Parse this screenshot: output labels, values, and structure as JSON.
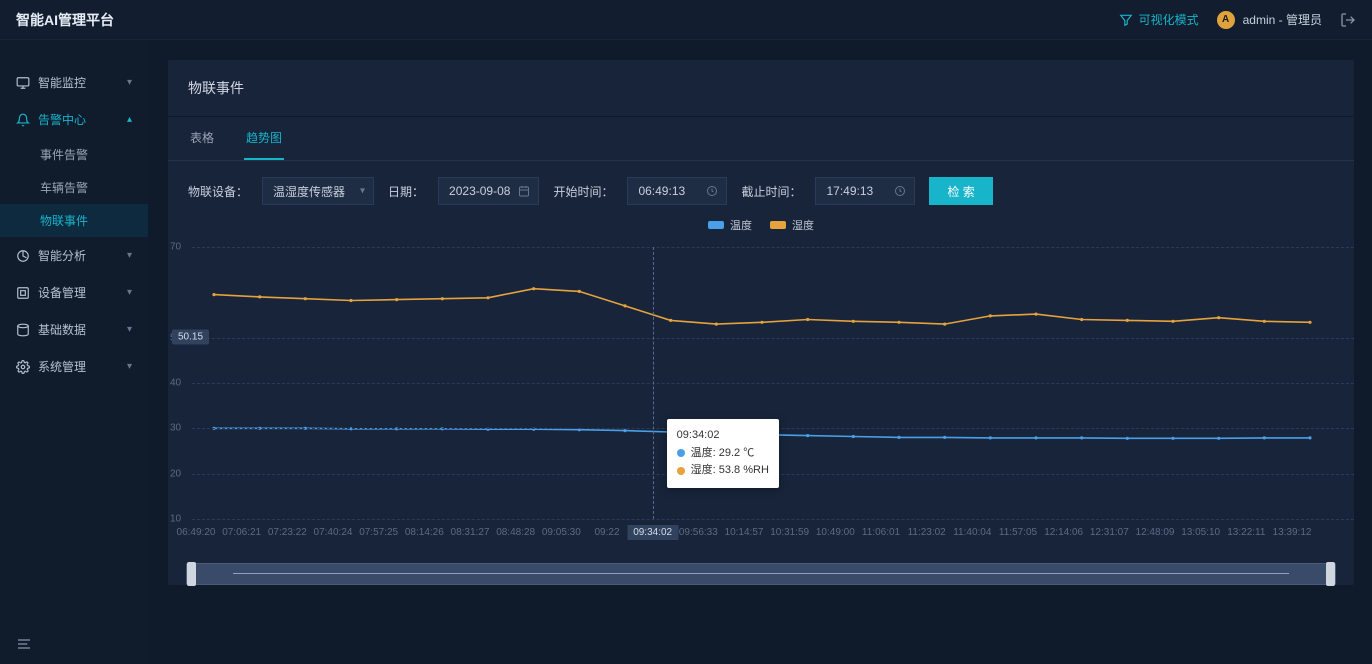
{
  "header": {
    "title": "智能AI管理平台",
    "mode_toggle": "可视化模式",
    "user_name": "admin",
    "user_role": "管理员",
    "avatar_letter": "A"
  },
  "sidebar": {
    "items": [
      {
        "label": "智能监控",
        "icon": "monitor-icon"
      },
      {
        "label": "告警中心",
        "icon": "bell-icon",
        "active": true,
        "children": [
          {
            "label": "事件告警"
          },
          {
            "label": "车辆告警"
          },
          {
            "label": "物联事件",
            "active": true
          }
        ]
      },
      {
        "label": "智能分析",
        "icon": "chart-icon"
      },
      {
        "label": "设备管理",
        "icon": "device-icon"
      },
      {
        "label": "基础数据",
        "icon": "database-icon"
      },
      {
        "label": "系统管理",
        "icon": "gear-icon"
      }
    ]
  },
  "page": {
    "title": "物联事件",
    "tabs": [
      {
        "label": "表格"
      },
      {
        "label": "趋势图",
        "active": true
      }
    ]
  },
  "filters": {
    "device_label": "物联设备：",
    "device_value": "温湿度传感器",
    "date_label": "日期：",
    "date_value": "2023-09-08",
    "start_label": "开始时间：",
    "start_value": "06:49:13",
    "end_label": "截止时间：",
    "end_value": "17:49:13",
    "search_btn": "检 索"
  },
  "legend": {
    "series": [
      {
        "name": "温度",
        "color": "#4a9fe8"
      },
      {
        "name": "湿度",
        "color": "#e6a23c"
      }
    ]
  },
  "tooltip": {
    "time": "09:34:02",
    "rows": [
      {
        "label": "温度",
        "value": "29.2 ℃",
        "color": "#4a9fe8"
      },
      {
        "label": "湿度",
        "value": "53.8 %RH",
        "color": "#e6a23c"
      }
    ]
  },
  "y_badge": "50.15",
  "chart_data": {
    "type": "line",
    "title": "",
    "xlabel": "",
    "ylabel": "",
    "ylim": [
      10,
      70
    ],
    "y_ticks": [
      10,
      20,
      30,
      40,
      50,
      70
    ],
    "x_labels": [
      "06:49:20",
      "07:06:21",
      "07:23:22",
      "07:40:24",
      "07:57:25",
      "08:14:26",
      "08:31:27",
      "08:48:28",
      "09:05:30",
      "09:22",
      "09:34:02",
      "09:56:33",
      "10:14:57",
      "10:31:59",
      "10:49:00",
      "11:06:01",
      "11:23:02",
      "11:40:04",
      "11:57:05",
      "12:14:06",
      "12:31:07",
      "12:48:09",
      "13:05:10",
      "13:22:11",
      "13:39:12"
    ],
    "crosshair_x_index": 10,
    "series": [
      {
        "name": "温度",
        "color": "#4a9fe8",
        "values": [
          30.0,
          30.0,
          30.0,
          29.9,
          29.9,
          29.9,
          29.8,
          29.8,
          29.7,
          29.5,
          29.2,
          28.9,
          28.6,
          28.4,
          28.2,
          28.0,
          28.0,
          27.9,
          27.9,
          27.9,
          27.8,
          27.8,
          27.8,
          27.9,
          27.9
        ]
      },
      {
        "name": "湿度",
        "color": "#e6a23c",
        "values": [
          59.5,
          59.0,
          58.6,
          58.2,
          58.4,
          58.6,
          58.8,
          60.8,
          60.2,
          57.0,
          53.8,
          53.0,
          53.4,
          54.0,
          53.6,
          53.4,
          53.0,
          54.8,
          55.2,
          54.0,
          53.8,
          53.6,
          54.4,
          53.6,
          53.4
        ]
      }
    ]
  }
}
